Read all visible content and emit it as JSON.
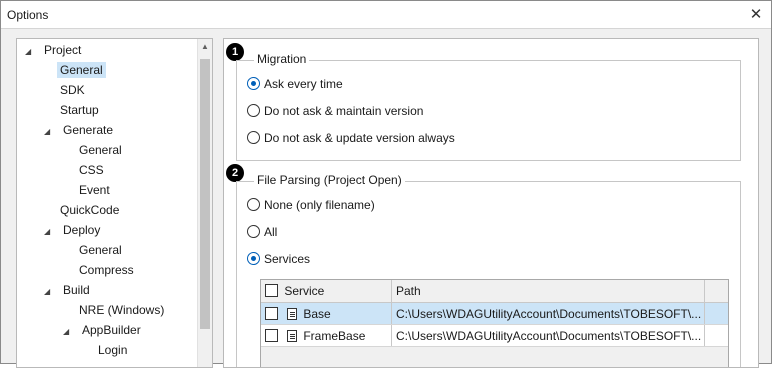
{
  "window": {
    "title": "Options",
    "close_glyph": "✕"
  },
  "tree": {
    "items": [
      {
        "label": "Project",
        "expanded": true
      },
      {
        "label": "General",
        "selected": true
      },
      {
        "label": "SDK"
      },
      {
        "label": "Startup"
      },
      {
        "label": "Generate",
        "expanded": true
      },
      {
        "label": "General"
      },
      {
        "label": "CSS"
      },
      {
        "label": "Event"
      },
      {
        "label": "QuickCode"
      },
      {
        "label": "Deploy",
        "expanded": true
      },
      {
        "label": "General"
      },
      {
        "label": "Compress"
      },
      {
        "label": "Build",
        "expanded": true
      },
      {
        "label": "NRE (Windows)"
      },
      {
        "label": "AppBuilder",
        "expanded": true
      },
      {
        "label": "Login"
      }
    ],
    "expand_glyph": "◢"
  },
  "badges": {
    "one": "1",
    "two": "2"
  },
  "migration": {
    "title": "Migration",
    "options": [
      "Ask every time",
      "Do not ask & maintain version",
      "Do not ask & update version always"
    ],
    "selected_index": 0
  },
  "file_parsing": {
    "title": "File Parsing (Project Open)",
    "options": [
      "None (only filename)",
      "All",
      "Services"
    ],
    "selected_index": 2
  },
  "services_grid": {
    "headers": {
      "service": "Service",
      "path": "Path"
    },
    "rows": [
      {
        "service": "Base",
        "path": "C:\\Users\\WDAGUtilityAccount\\Documents\\TOBESOFT\\...",
        "selected": true
      },
      {
        "service": "FrameBase",
        "path": "C:\\Users\\WDAGUtilityAccount\\Documents\\TOBESOFT\\..."
      }
    ]
  }
}
